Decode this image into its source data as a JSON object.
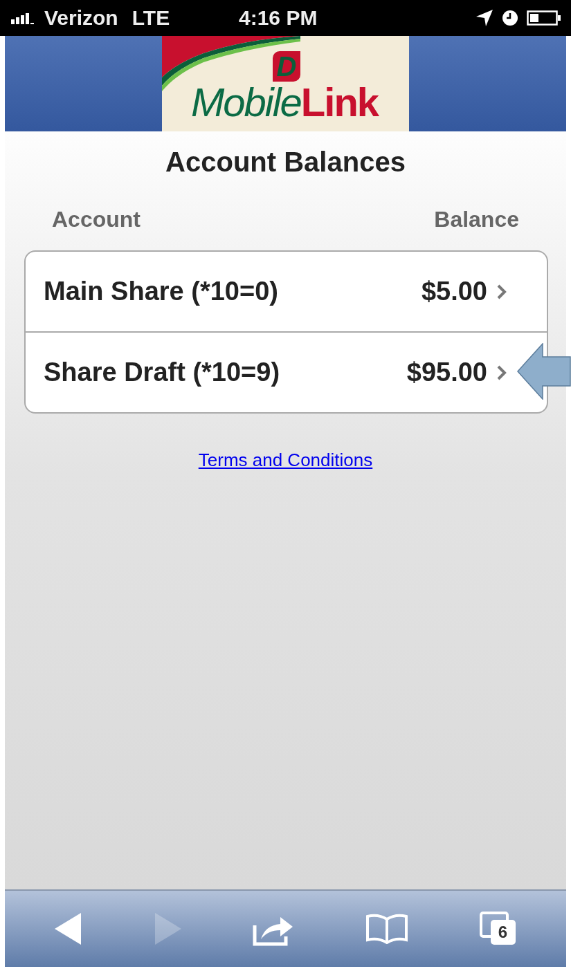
{
  "status_bar": {
    "carrier": "Verizon",
    "network": "LTE",
    "time": "4:16 PM"
  },
  "header": {
    "logo_mark": "D",
    "logo_words": [
      "Mobile",
      "Link"
    ]
  },
  "title": "Account Balances",
  "columns": [
    "Account",
    "Balance"
  ],
  "accounts": [
    {
      "name": "Main Share (*10=0)",
      "balance": "$5.00"
    },
    {
      "name": "Share Draft (*10=9)",
      "balance": "$95.00"
    }
  ],
  "link": "Terms and Conditions",
  "toolbar": {
    "back_disabled": false,
    "forward_disabled": true,
    "tabs_count": "6"
  }
}
